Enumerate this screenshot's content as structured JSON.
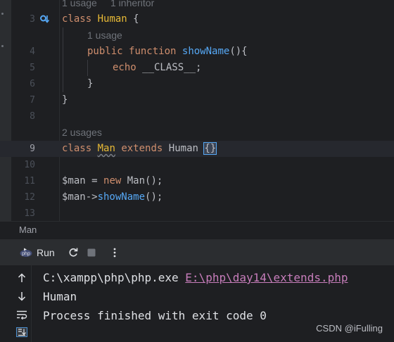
{
  "editor": {
    "hints": {
      "line3_usages": "1 usage",
      "line3_inheritors": "1 inheritor",
      "line4": "1 usage",
      "line9": "2 usages"
    },
    "line_numbers": [
      "3",
      "4",
      "5",
      "6",
      "7",
      "8",
      "9",
      "10",
      "11",
      "12",
      "13"
    ],
    "code": {
      "l3": {
        "kw": "class",
        "cls": "Human",
        "rest": " {"
      },
      "l4": {
        "kw1": "public",
        "kw2": "function",
        "fn": "showName",
        "rest": "(){"
      },
      "l5": {
        "kw": "echo",
        "rest": " __CLASS__;"
      },
      "l6": "}",
      "l7": "}",
      "l9": {
        "kw1": "class",
        "cls": "Man",
        "kw2": "extends",
        "base": "Human",
        "brace": "{}"
      },
      "l11": {
        "var": "$man",
        "eq": " = ",
        "kw": "new",
        "rest": " Man();"
      },
      "l12": {
        "var": "$man",
        "arrow": "->",
        "fn": "showName",
        "rest": "();"
      }
    }
  },
  "breadcrumb": {
    "label": "Man"
  },
  "run_toolbar": {
    "tab_label": "Run",
    "tab_icon": "php-run-icon"
  },
  "console": {
    "lines": {
      "cmd_prefix": "C:\\xampp\\php\\php.exe ",
      "cmd_link": "E:\\php\\day14\\extends.php",
      "output": "Human",
      "exit": "Process finished with exit code 0"
    }
  },
  "watermark": "CSDN @iFulling",
  "colors": {
    "background": "#1e1f22",
    "keyword": "#cf8e6d",
    "class_name": "#e8ba36",
    "function": "#56a8f5",
    "variable": "#c77dbb",
    "link": "#c77dbb"
  }
}
